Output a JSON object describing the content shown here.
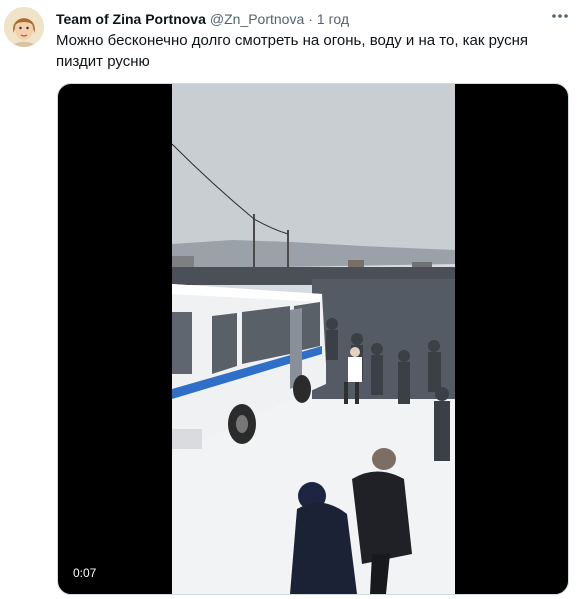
{
  "tweet": {
    "display_name": "Team of Zina Portnova",
    "handle": "@Zn_Portnova",
    "separator": "·",
    "time": "1 год",
    "text": "Можно бесконечно долго смотреть на огонь, воду и на то, как русня пиздит русню",
    "more_icon": "more-dots-icon"
  },
  "media": {
    "type": "video",
    "duration": "0:07"
  },
  "colors": {
    "text": "#0f1419",
    "muted": "#536471",
    "media_bg": "#000000",
    "border": "#cfd9de"
  }
}
